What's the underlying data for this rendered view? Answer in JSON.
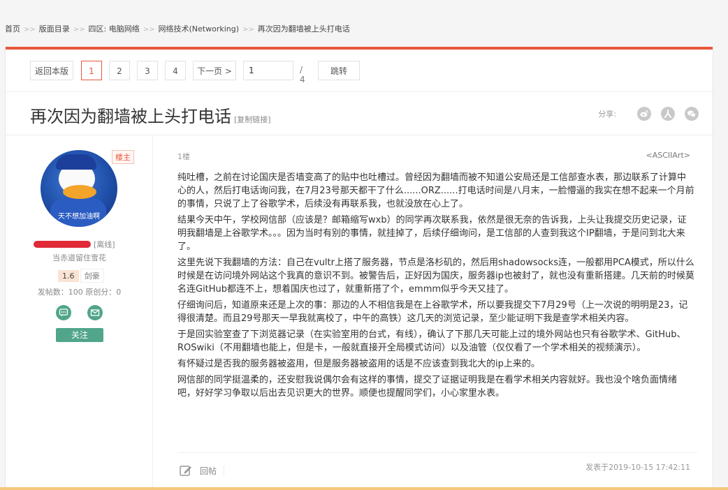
{
  "breadcrumbs": {
    "items": [
      "首页",
      "版面目录",
      "四区: 电脑网络",
      "网络技术(Networking)",
      "再次因为翻墙被上头打电话"
    ],
    "separator": ">>"
  },
  "pager": {
    "back_label": "返回本版",
    "pages": [
      "1",
      "2",
      "3",
      "4"
    ],
    "current_page": "1",
    "next_label": "下一页 >",
    "page_input_value": "1",
    "total": "/ 4",
    "jump_label": "跳转"
  },
  "thread": {
    "title": "再次因为翻墙被上头打电话",
    "copy_link": "[复制链接]",
    "share_label": "分享:"
  },
  "author": {
    "badge": "楼主",
    "avatar_caption": "天不想加油啊",
    "status": "[离线]",
    "motto": "当赤道留住雪花",
    "level": "1.6",
    "level_name": "剑豪",
    "stats": "发帖数：100   原创分：0",
    "follow_label": "关注"
  },
  "post": {
    "floor": "1楼",
    "signature_tag": "<ASCIIArt>",
    "paragraphs": [
      "纯吐槽，之前在讨论国庆是否墙变高了的贴中也吐槽过。曾经因为翻墙而被不知道公安局还是工信部查水表，那边联系了计算中心的人，然后打电话询问我，在7月23号那天都干了什么......ORZ......打电话时间是八月末，一脸懵逼的我实在想不起来一个月前的事情，只说了上了谷歌学术，后续没有再联系我，也就没放在心上了。",
      "结果今天中午，学校网信部（应该是？邮箱缩写wxb）的同学再次联系我，依然是很无奈的告诉我，上头让我提交历史记录，证明我翻墙是上谷歌学术。。。因为当时有别的事情，就挂掉了，后续仔细询问，是工信部的人查到我这个IP翻墙，于是问到北大来了。",
      "这里先说下我翻墙的方法：自己在vultr上搭了服务器，节点是洛杉矶的，然后用shadowsocks连，一般都用PCA模式，所以什么时候是在访问境外网站这个我真的意识不到。被警告后，正好因为国庆，服务器ip也被封了，就也没有重新搭建。几天前的时候莫名连GitHub都连不上，想着国庆也过了，就重新搭了个，emmm似乎今天又挂了。",
      "仔细询问后，知道原来还是上次的事：那边的人不相信我是在上谷歌学术，所以要我提交下7月29号（上一次说的明明是23，记得很清楚。而且29号那天一早我就离校了，中午的高铁）这几天的浏览记录，至少能证明下我是查学术相关内容。",
      "于是回实验室查了下浏览器记录（在实验室用的台式，有线），确认了下那几天可能上过的境外网站也只有谷歌学术、GitHub、ROSwiki（不用翻墙也能上，但是卡，一般就直接开全局模式访问）以及油管（仅仅看了一个学术相关的视频演示）。",
      "有怀疑过是否我的服务器被盗用，但是服务器被盗用的话是不应该查到我北大的ip上来的。",
      "网信部的同学挺温柔的，还安慰我说偶尔会有这样的事情，提交了证据证明我是在看学术相关内容就好。我也没个啥负面情绪吧，好好学习争取以后出去见识更大的世界。顺便也提醒同学们，小心家里水表。"
    ],
    "reply_label": "回帖",
    "posted_at": "发表于2019-10-15 17:42:11"
  },
  "colors": {
    "accent": "#e8573c",
    "green": "#50a58b",
    "redact": "#e02a38"
  },
  "icons": [
    "weibo-icon",
    "renren-icon",
    "wechat-icon",
    "message-icon",
    "mail-icon",
    "edit-icon"
  ]
}
